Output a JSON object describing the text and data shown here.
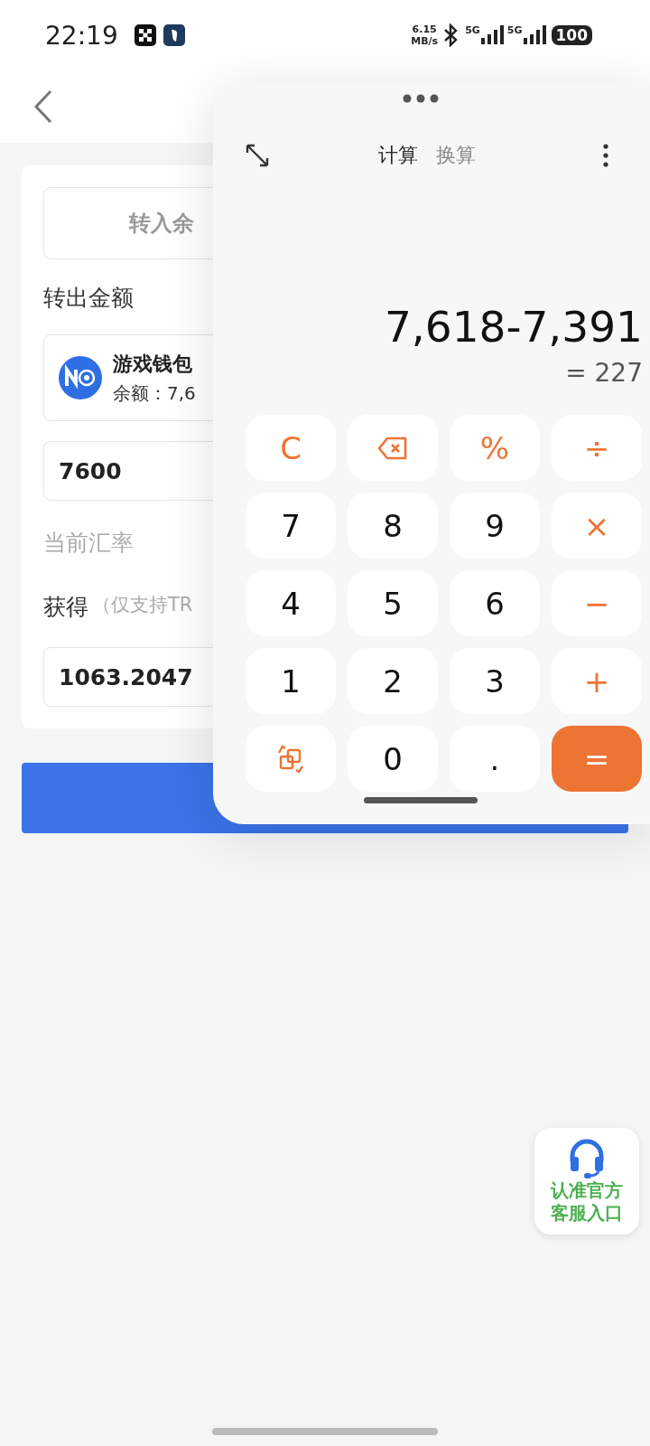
{
  "status_bar": {
    "time": "22:19",
    "speed": "6.15",
    "speed_unit": "MB/s",
    "networks": [
      "5G",
      "5G"
    ],
    "battery": "100"
  },
  "form": {
    "top_button": "转入余",
    "out_label": "转出金额",
    "wallet": {
      "name": "游戏钱包",
      "balance": "余额：7,6"
    },
    "amount": "7600",
    "rate_label": "当前汇率",
    "receive_label": "获得",
    "receive_note": "（仅支持TR",
    "receive_value": "1063.2047"
  },
  "calculator": {
    "tabs": [
      {
        "label": "计算",
        "selected": true
      },
      {
        "label": "换算",
        "selected": false
      }
    ],
    "expression": "7,618-7,391",
    "result": "= 227",
    "keys": [
      {
        "kind": "op",
        "label": "C"
      },
      {
        "kind": "delete"
      },
      {
        "kind": "op",
        "label": "%"
      },
      {
        "kind": "op",
        "label": "÷"
      },
      {
        "kind": "digit",
        "label": "7"
      },
      {
        "kind": "digit",
        "label": "8"
      },
      {
        "kind": "digit",
        "label": "9"
      },
      {
        "kind": "op",
        "label": "×"
      },
      {
        "kind": "digit",
        "label": "4"
      },
      {
        "kind": "digit",
        "label": "5"
      },
      {
        "kind": "digit",
        "label": "6"
      },
      {
        "kind": "op",
        "label": "−"
      },
      {
        "kind": "digit",
        "label": "1"
      },
      {
        "kind": "digit",
        "label": "2"
      },
      {
        "kind": "digit",
        "label": "3"
      },
      {
        "kind": "op",
        "label": "+"
      },
      {
        "kind": "convert"
      },
      {
        "kind": "digit",
        "label": "0"
      },
      {
        "kind": "digit",
        "label": "."
      },
      {
        "kind": "equals",
        "label": "="
      }
    ]
  },
  "support": {
    "lines": [
      "认准官方",
      "客服入口"
    ]
  }
}
